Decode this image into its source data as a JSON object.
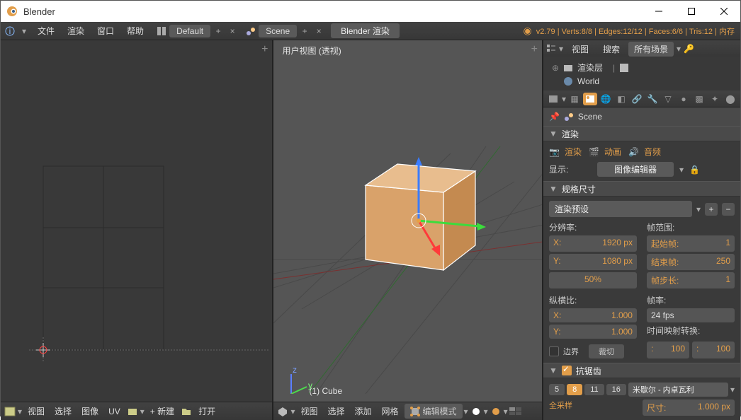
{
  "window": {
    "title": "Blender"
  },
  "topmenu": {
    "file": "文件",
    "render": "渲染",
    "window": "窗口",
    "help": "帮助",
    "layout": "Default",
    "scene": "Scene",
    "engine": "Blender 渲染"
  },
  "stats": "v2.79 | Verts:8/8 | Edges:12/12 | Faces:6/6 | Tris:12 | 内存",
  "midview": {
    "label": "用户视图 (透视)",
    "object": "(1) Cube"
  },
  "leftbar": {
    "view": "视图",
    "select": "选择",
    "image": "图像",
    "uv": "UV",
    "new": "新建",
    "open": "打开"
  },
  "midbar": {
    "view": "视图",
    "select": "选择",
    "add": "添加",
    "mesh": "网格",
    "mode": "编辑模式"
  },
  "outliner": {
    "view": "视图",
    "search": "搜索",
    "scenes": "所有场景",
    "renderlayer": "渲染层",
    "world": "World"
  },
  "props": {
    "scene_label": "Scene",
    "render_hdr": "渲染",
    "btn_render": "渲染",
    "btn_anim": "动画",
    "btn_audio": "音频",
    "display_lbl": "显示:",
    "display_val": "图像编辑器",
    "dims_hdr": "规格尺寸",
    "preset": "渲染预设",
    "reso_lbl": "分辨率:",
    "range_lbl": "帧范围:",
    "x_lbl": "X:",
    "y_lbl": "Y:",
    "resx": "1920 px",
    "resy": "1080 px",
    "pct": "50%",
    "start_lbl": "起始帧:",
    "start": "1",
    "end_lbl": "结束帧:",
    "end": "250",
    "step_lbl": "帧步长:",
    "step": "1",
    "aspect_lbl": "纵横比:",
    "rate_lbl": "帧率:",
    "ax": "1.000",
    "ay": "1.000",
    "fps": "24 fps",
    "border_lbl": "边界",
    "crop_lbl": "裁切",
    "remap_lbl": "时间映射转换:",
    "remap1": "100",
    "remap2": "100",
    "aa_hdr": "抗锯齿",
    "samples": [
      "5",
      "8",
      "11",
      "16"
    ],
    "filter": "米歇尔 - 内卓瓦利",
    "full_lbl": "全采样",
    "size_lbl": "尺寸:",
    "size_val": "1.000 px"
  }
}
